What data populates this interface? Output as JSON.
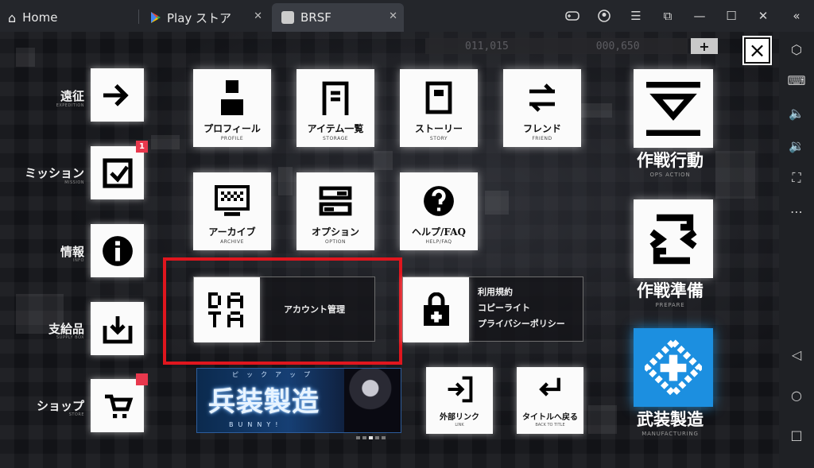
{
  "window": {
    "tabs": [
      {
        "label": "Home",
        "icon": "home-icon"
      },
      {
        "label": "Play ストア",
        "icon": "play-store-icon"
      },
      {
        "label": "BRSF",
        "icon": "app-icon"
      }
    ],
    "controls": [
      "gamepad-icon",
      "account-icon",
      "menu-icon",
      "screen-icon",
      "minimize-icon",
      "maximize-icon",
      "close-icon",
      "collapse-icon"
    ]
  },
  "sidebar": {
    "icons": [
      "hexagon-icon",
      "keyboard-icon",
      "volume-up-icon",
      "volume-down-icon",
      "screenshot-icon",
      "more-icon",
      "back-icon",
      "home-circle-icon",
      "recent-icon"
    ]
  },
  "hud": {
    "currency_a": "011,015",
    "currency_b": "000,650",
    "plus_label": "+",
    "close_label": "×"
  },
  "side_menu": [
    {
      "label": "遠征",
      "sub": "EXPEDITION"
    },
    {
      "label": "ミッション",
      "sub": "MISSION",
      "badge": "1"
    },
    {
      "label": "情報",
      "sub": "INFO"
    },
    {
      "label": "支給品",
      "sub": "SUPPLY BOX"
    },
    {
      "label": "ショップ",
      "sub": "STORE",
      "badge": ""
    }
  ],
  "grid": [
    {
      "label": "プロフィール",
      "sub": "PROFILE"
    },
    {
      "label": "アイテム一覧",
      "sub": "STORAGE"
    },
    {
      "label": "ストーリー",
      "sub": "STORY"
    },
    {
      "label": "フレンド",
      "sub": "FRIEND"
    },
    {
      "label": "アーカイブ",
      "sub": "ARCHIVE"
    },
    {
      "label": "オプション",
      "sub": "OPTION"
    },
    {
      "label": "ヘルプ/FAQ",
      "sub": "HELP/FAQ"
    }
  ],
  "account": {
    "label": "アカウント管理"
  },
  "terms": {
    "line1": "利用規約",
    "line2": "コピーライト",
    "line3": "プライバシーポリシー"
  },
  "big_menu": [
    {
      "label": "作戦行動",
      "sub": "OPS ACTION"
    },
    {
      "label": "作戦準備",
      "sub": "PREPARE"
    },
    {
      "label": "武装製造",
      "sub": "MANUFACTURING"
    }
  ],
  "banner": {
    "title": "兵装製造",
    "ruby": "ピックアップ",
    "sub": "BUNNY!",
    "page_count": 5,
    "active_page": 3
  },
  "small_tiles": [
    {
      "label": "外部リンク",
      "sub": "LINK"
    },
    {
      "label": "タイトルへ戻る",
      "sub": "BACK TO TITLE"
    }
  ],
  "colors": {
    "highlight": "#e0161e",
    "accent_blue": "#1c8fe0",
    "badge": "#e8384d"
  }
}
